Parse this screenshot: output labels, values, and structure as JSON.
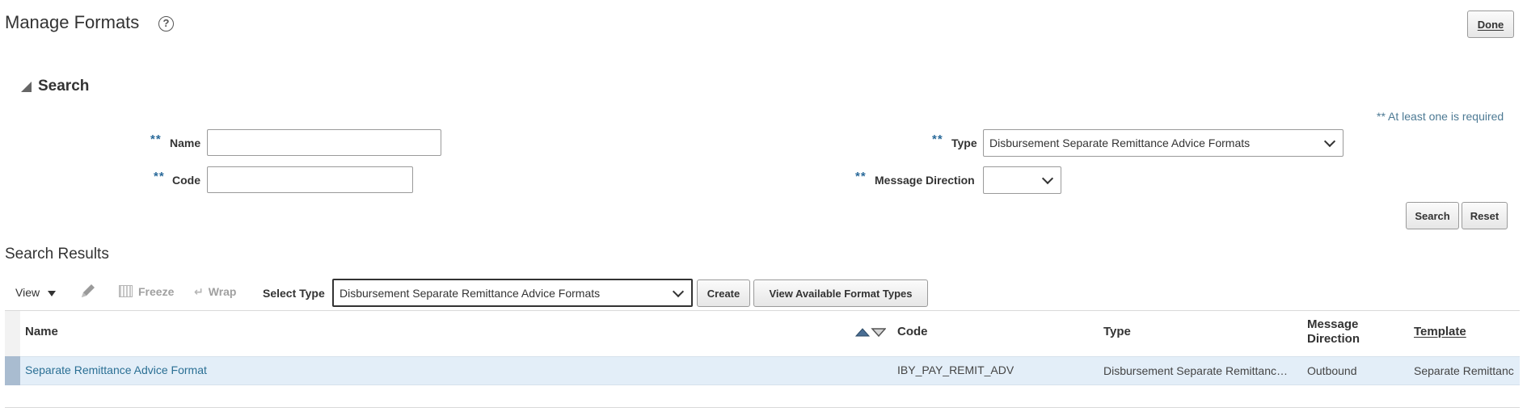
{
  "page": {
    "title": "Manage Formats",
    "help_icon": "question-circle-icon",
    "done_label": "Done"
  },
  "search": {
    "header": "Search",
    "required_note": "** At least one is required",
    "required_marker": "**",
    "fields": {
      "name": {
        "label": "Name",
        "value": "",
        "placeholder": ""
      },
      "code": {
        "label": "Code",
        "value": "",
        "placeholder": ""
      },
      "type": {
        "label": "Type",
        "value": "Disbursement Separate Remittance Advice Formats"
      },
      "message_direction": {
        "label": "Message Direction",
        "value": ""
      }
    },
    "search_label": "Search",
    "reset_label": "Reset"
  },
  "results": {
    "title": "Search Results",
    "toolbar": {
      "view_label": "View",
      "edit_icon": "pencil-icon",
      "freeze_label": "Freeze",
      "wrap_label": "Wrap",
      "select_type_label": "Select Type",
      "select_type_value": "Disbursement Separate Remittance Advice Formats",
      "create_label": "Create",
      "view_types_label": "View Available Format Types"
    },
    "columns": {
      "name": "Name",
      "code": "Code",
      "type": "Type",
      "direction_line1": "Message",
      "direction_line2": "Direction",
      "template": "Template"
    },
    "sort_icons": [
      "sort-ascending-icon",
      "sort-descending-icon"
    ],
    "rows": [
      {
        "name": "Separate Remittance Advice Format",
        "code": "IBY_PAY_REMIT_ADV",
        "type": "Disbursement Separate Remittanc…",
        "direction": "Outbound",
        "template": "Separate Remittanc"
      }
    ]
  }
}
